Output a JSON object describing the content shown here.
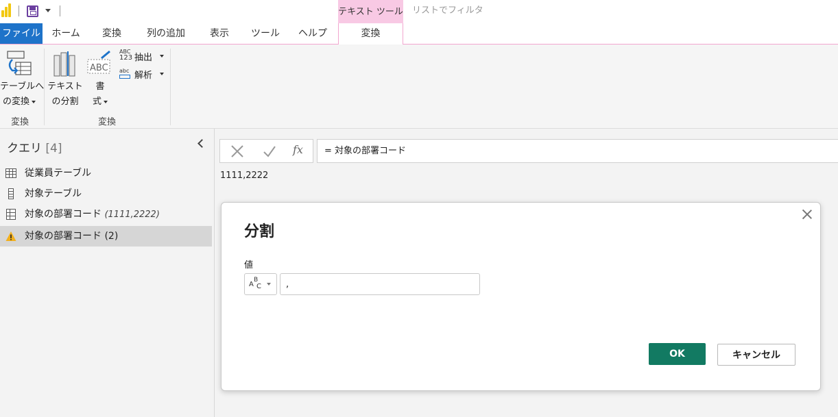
{
  "context_tabs": {
    "group_label": "テキスト ツール",
    "secondary_label": "リストでフィルタ"
  },
  "tabs": [
    {
      "label": "ファイル"
    },
    {
      "label": "ホーム"
    },
    {
      "label": "変換"
    },
    {
      "label": "列の追加"
    },
    {
      "label": "表示"
    },
    {
      "label": "ツール"
    },
    {
      "label": "ヘルプ"
    },
    {
      "label": "変換"
    }
  ],
  "ribbon": {
    "convert_to_table": {
      "line1": "テーブルへ",
      "line2": "の変換"
    },
    "group_convert_label": "変換",
    "split_text": {
      "line1": "テキスト",
      "line2": "の分割"
    },
    "format": {
      "line1": "書",
      "line2": "式"
    },
    "extract": "抽出",
    "parse": "解析",
    "group_transform_label": "変換",
    "icon_abc": "ABC",
    "icon_123": "123",
    "icon_abc_small": "abc"
  },
  "query_pane": {
    "title": "クエリ",
    "count": "[4]",
    "items": [
      {
        "label": "従業員テーブル",
        "detail": "",
        "icon": "table-icon"
      },
      {
        "label": "対象テーブル",
        "detail": "",
        "icon": "list-icon"
      },
      {
        "label": "対象の部署コード",
        "detail": "(1111,2222)",
        "icon": "parameter-icon"
      },
      {
        "label": "対象の部署コード (2)",
        "detail": "",
        "icon": "warning-icon"
      }
    ]
  },
  "formula_bar": {
    "fx_label": "fx",
    "formula": "=  対象の部署コード"
  },
  "preview_value": "1111,2222",
  "dialog": {
    "title": "分割",
    "value_label": "値",
    "type_icon_text": "ABC",
    "input_value": ",",
    "ok_label": "OK",
    "cancel_label": "キャンセル"
  },
  "colors": {
    "file_tab": "#1e73c9",
    "context_tab": "#f8c9e4",
    "ok_button": "#127a62",
    "warning": "#f2b01e",
    "logo": "#f2c811",
    "save_icon": "#6b3fa0"
  }
}
